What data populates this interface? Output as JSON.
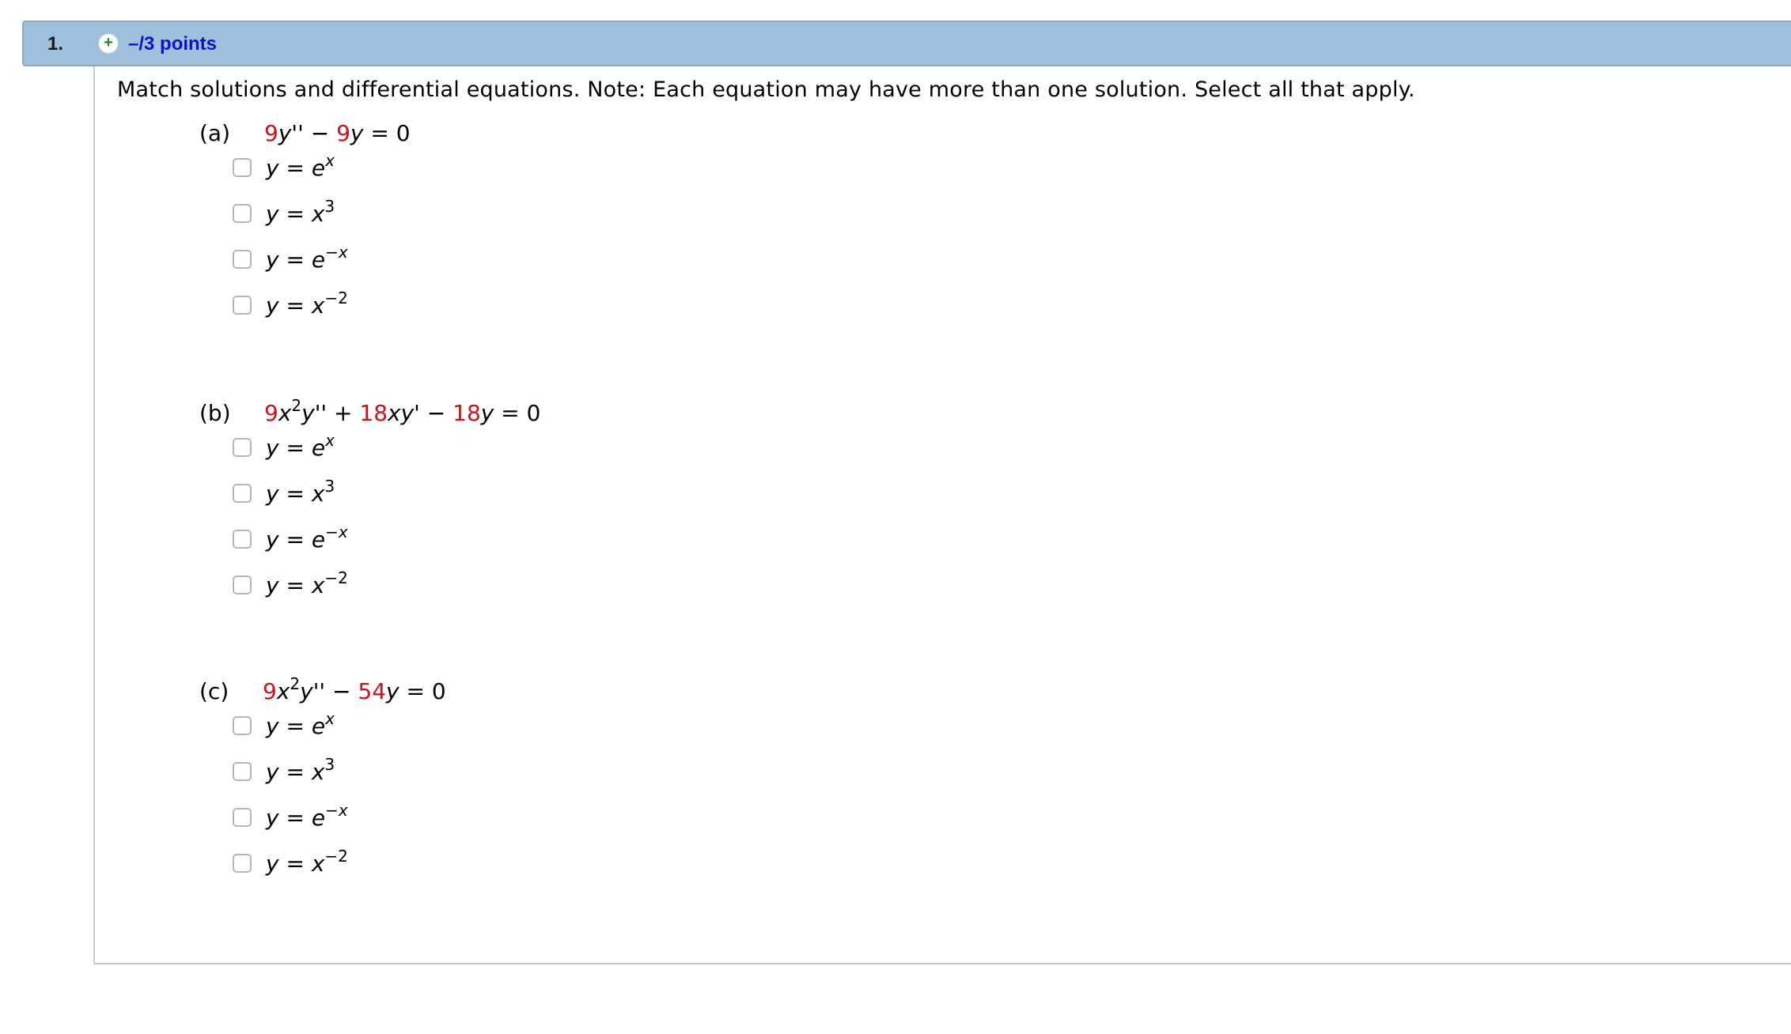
{
  "question": {
    "number": "1.",
    "points": "–/3 points",
    "prompt": "Match solutions and differential equations. Note: Each equation may have more than one solution. Select all that apply."
  },
  "options": [
    {
      "lhs": "y",
      "eq": " = ",
      "base": "e",
      "exp": "x"
    },
    {
      "lhs": "y",
      "eq": " = ",
      "base": "x",
      "exp": "3"
    },
    {
      "lhs": "y",
      "eq": " = ",
      "base": "e",
      "exp": "−x"
    },
    {
      "lhs": "y",
      "eq": " = ",
      "base": "x",
      "exp": "−2"
    }
  ],
  "parts": [
    {
      "label": "(a)",
      "equation": [
        "9",
        "y''",
        " − ",
        "9",
        "y",
        " = 0"
      ]
    },
    {
      "label": "(b)",
      "equation": [
        "9",
        "x",
        "2",
        "y''",
        " + ",
        "18",
        "xy'",
        " − ",
        "18",
        "y",
        " = 0"
      ]
    },
    {
      "label": "(c)",
      "equation": [
        "9",
        "x",
        "2",
        "y''",
        " − ",
        "54",
        "y",
        " = 0"
      ]
    }
  ]
}
